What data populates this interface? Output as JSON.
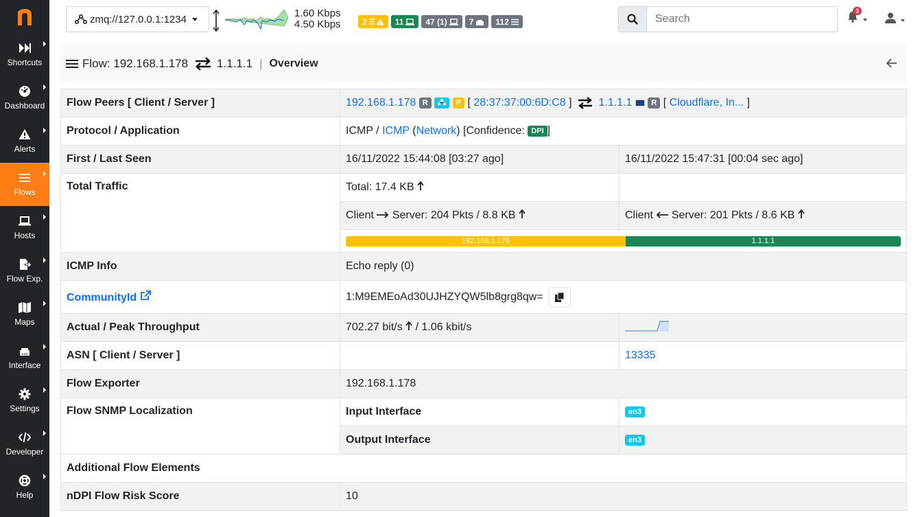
{
  "sidebar": {
    "items": [
      {
        "label": "Shortcuts",
        "icon": "fast-forward-icon"
      },
      {
        "label": "Dashboard",
        "icon": "gauge-icon"
      },
      {
        "label": "Alerts",
        "icon": "warning-icon"
      },
      {
        "label": "Flows",
        "icon": "list-icon",
        "active": true
      },
      {
        "label": "Hosts",
        "icon": "laptop-icon"
      },
      {
        "label": "Flow Exp.",
        "icon": "file-export-icon"
      },
      {
        "label": "Maps",
        "icon": "map-icon"
      },
      {
        "label": "Interface",
        "icon": "ethernet-icon"
      },
      {
        "label": "Settings",
        "icon": "gear-icon"
      },
      {
        "label": "Developer",
        "icon": "code-icon"
      },
      {
        "label": "Help",
        "icon": "life-ring-icon"
      }
    ]
  },
  "topbar": {
    "interface": "zmq://127.0.0.1:1234",
    "upload_rate": "1.60 Kbps",
    "download_rate": "4.50 Kbps",
    "badges": [
      {
        "label": "2",
        "icon": "list-warning-icon",
        "color": "#ffc107"
      },
      {
        "label": "11",
        "icon": "laptop-icon",
        "color": "#198754"
      },
      {
        "label": "47 (1)",
        "icon": "laptop-icon",
        "color": "#6c757d"
      },
      {
        "label": "7",
        "icon": "ethernet-icon",
        "color": "#6c757d"
      },
      {
        "label": "112",
        "icon": "list-icon",
        "color": "#6c757d"
      }
    ],
    "search_placeholder": "Search",
    "notification_count": "3"
  },
  "header": {
    "flow_prefix": "Flow: 192.168.1.178",
    "server": "1.1.1.1",
    "section": "Overview"
  },
  "table": {
    "peers_label": "Flow Peers [ Client / Server ]",
    "client_ip": "192.168.1.178",
    "client_tag_r": "R",
    "client_tag_p": "P",
    "client_mac": "28:37:37:00:6D:C8",
    "server_ip": "1.1.1.1",
    "server_tag_r": "R",
    "server_name": "Cloudflare, In...",
    "protocol_label": "Protocol / Application",
    "protocol_l4": "ICMP /",
    "protocol_app": "ICMP",
    "protocol_category": "Network",
    "confidence_label": "[Confidence:",
    "confidence_value": "DPI",
    "seen_label": "First / Last Seen",
    "first_seen": "16/11/2022 15:44:08 [03:27 ago]",
    "last_seen": "16/11/2022 15:47:31 [00:04 sec ago]",
    "traffic_label": "Total Traffic",
    "total": "Total: 17.4 KB",
    "cli2srv": "Server: 204 Pkts / 8.8 KB",
    "srv2cli": "Server: 201 Pkts / 8.6 KB",
    "client_word": "Client",
    "ratio_client": "192.168.1.178",
    "ratio_server": "1.1.1.1",
    "icmp_label": "ICMP Info",
    "icmp_value": "Echo reply (0)",
    "community_label": "CommunityId",
    "community_value": "1:M9EMEoAd30UJHZYQW5lb8grg8qw=",
    "throughput_label": "Actual / Peak Throughput",
    "throughput_actual": "702.27 bit/s",
    "throughput_peak": "/ 1.06 kbit/s",
    "asn_label": "ASN [ Client / Server ]",
    "asn_server": "13335",
    "exporter_label": "Flow Exporter",
    "exporter_value": "192.168.1.178",
    "snmp_label": "Flow SNMP Localization",
    "input_label": "Input Interface",
    "input_value": "en3",
    "output_label": "Output Interface",
    "output_value": "en3",
    "additional_label": "Additional Flow Elements",
    "risk_label": "nDPI Flow Risk Score",
    "risk_value": "10"
  },
  "chart_data": {
    "type": "ratio",
    "series": [
      {
        "name": "192.168.1.178",
        "value": 50.4
      },
      {
        "name": "1.1.1.1",
        "value": 49.6
      }
    ]
  }
}
